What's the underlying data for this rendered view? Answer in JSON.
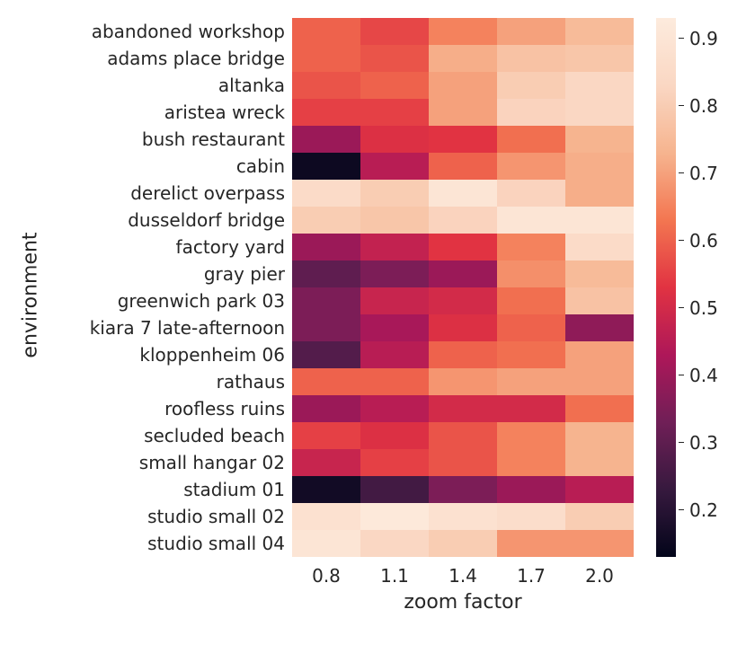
{
  "chart_data": {
    "type": "heatmap",
    "xlabel": "zoom factor",
    "ylabel": "environment",
    "x": [
      "0.8",
      "1.1",
      "1.4",
      "1.7",
      "2.0"
    ],
    "y": [
      "abandoned workshop",
      "adams place bridge",
      "altanka",
      "aristea wreck",
      "bush restaurant",
      "cabin",
      "derelict overpass",
      "dusseldorf bridge",
      "factory yard",
      "gray pier",
      "greenwich park 03",
      "kiara 7 late-afternoon",
      "kloppenheim 06",
      "rathaus",
      "roofless ruins",
      "secluded beach",
      "small hangar 02",
      "stadium 01",
      "studio small 02",
      "studio small 04"
    ],
    "values": [
      [
        0.6,
        0.56,
        0.65,
        0.7,
        0.75
      ],
      [
        0.6,
        0.58,
        0.72,
        0.77,
        0.78
      ],
      [
        0.58,
        0.6,
        0.7,
        0.8,
        0.83
      ],
      [
        0.55,
        0.55,
        0.7,
        0.82,
        0.83
      ],
      [
        0.4,
        0.52,
        0.53,
        0.62,
        0.73
      ],
      [
        0.15,
        0.45,
        0.6,
        0.68,
        0.72
      ],
      [
        0.85,
        0.8,
        0.9,
        0.82,
        0.72
      ],
      [
        0.8,
        0.78,
        0.82,
        0.9,
        0.9
      ],
      [
        0.4,
        0.47,
        0.53,
        0.65,
        0.85
      ],
      [
        0.3,
        0.35,
        0.4,
        0.67,
        0.75
      ],
      [
        0.35,
        0.48,
        0.5,
        0.62,
        0.77
      ],
      [
        0.35,
        0.42,
        0.52,
        0.6,
        0.38
      ],
      [
        0.28,
        0.45,
        0.6,
        0.62,
        0.7
      ],
      [
        0.6,
        0.6,
        0.68,
        0.7,
        0.7
      ],
      [
        0.4,
        0.45,
        0.5,
        0.5,
        0.62
      ],
      [
        0.55,
        0.52,
        0.58,
        0.65,
        0.73
      ],
      [
        0.48,
        0.55,
        0.58,
        0.65,
        0.73
      ],
      [
        0.16,
        0.25,
        0.35,
        0.4,
        0.45
      ],
      [
        0.88,
        0.92,
        0.88,
        0.86,
        0.8
      ],
      [
        0.9,
        0.83,
        0.8,
        0.68,
        0.68
      ]
    ],
    "vmin": 0.13,
    "vmax": 0.93,
    "colorbar_ticks": [
      0.2,
      0.3,
      0.4,
      0.5,
      0.6,
      0.7,
      0.8,
      0.9
    ],
    "colorbar_tick_labels": [
      "0.2",
      "0.3",
      "0.4",
      "0.5",
      "0.6",
      "0.7",
      "0.8",
      "0.9"
    ],
    "cmap_stops": [
      [
        0.0,
        "#03051a"
      ],
      [
        0.125,
        "#36193e"
      ],
      [
        0.25,
        "#701f57"
      ],
      [
        0.375,
        "#ae1759"
      ],
      [
        0.5,
        "#e13342"
      ],
      [
        0.625,
        "#f37651"
      ],
      [
        0.75,
        "#f6b48f"
      ],
      [
        0.875,
        "#fad7c3"
      ],
      [
        1.0,
        "#fdebdd"
      ]
    ]
  }
}
